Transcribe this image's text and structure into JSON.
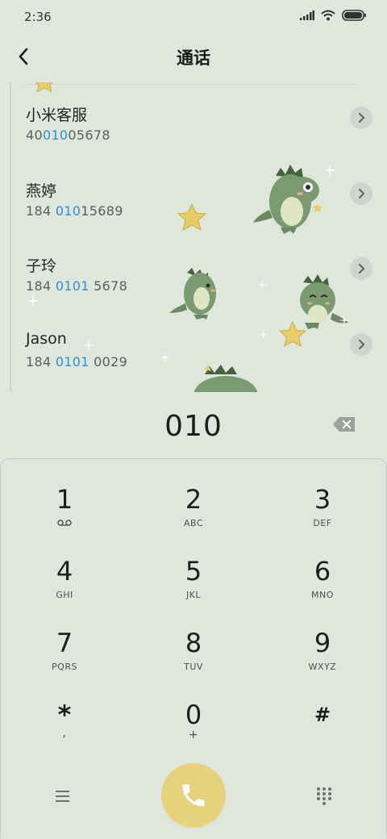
{
  "status_bar": {
    "time": "2:36"
  },
  "header": {
    "title": "通话"
  },
  "contacts": [
    {
      "name": "小米客服",
      "number_pre": "40",
      "number_match": "010",
      "number_post": "05678"
    },
    {
      "name": "燕婷",
      "number_pre": "184 ",
      "number_match": "010",
      "number_post": "15689"
    },
    {
      "name": "子玲",
      "number_pre": "184 ",
      "number_match": "0101",
      "number_post": " 5678"
    },
    {
      "name": "Jason",
      "number_pre": "184 ",
      "number_match": "0101",
      "number_post": " 0029"
    }
  ],
  "dialer": {
    "dialed": "010"
  },
  "keypad": [
    {
      "digit": "1",
      "letters": ""
    },
    {
      "digit": "2",
      "letters": "ABC"
    },
    {
      "digit": "3",
      "letters": "DEF"
    },
    {
      "digit": "4",
      "letters": "GHI"
    },
    {
      "digit": "5",
      "letters": "JKL"
    },
    {
      "digit": "6",
      "letters": "MNO"
    },
    {
      "digit": "7",
      "letters": "PQRS"
    },
    {
      "digit": "8",
      "letters": "TUV"
    },
    {
      "digit": "9",
      "letters": "WXYZ"
    },
    {
      "digit": "*",
      "letters": ","
    },
    {
      "digit": "0",
      "letters": "+"
    },
    {
      "digit": "#",
      "letters": ""
    }
  ],
  "colors": {
    "background": "#dfe7dd",
    "match_highlight": "#2e8fd6",
    "call_button": "#e6d27d",
    "dino": "#7a9a72"
  },
  "icons": {
    "back": "chevron-left-icon",
    "detail": "chevron-right-icon",
    "backspace": "backspace-icon",
    "voicemail": "voicemail-icon",
    "menu": "menu-icon",
    "call": "phone-icon",
    "dialpad": "dialpad-icon"
  }
}
